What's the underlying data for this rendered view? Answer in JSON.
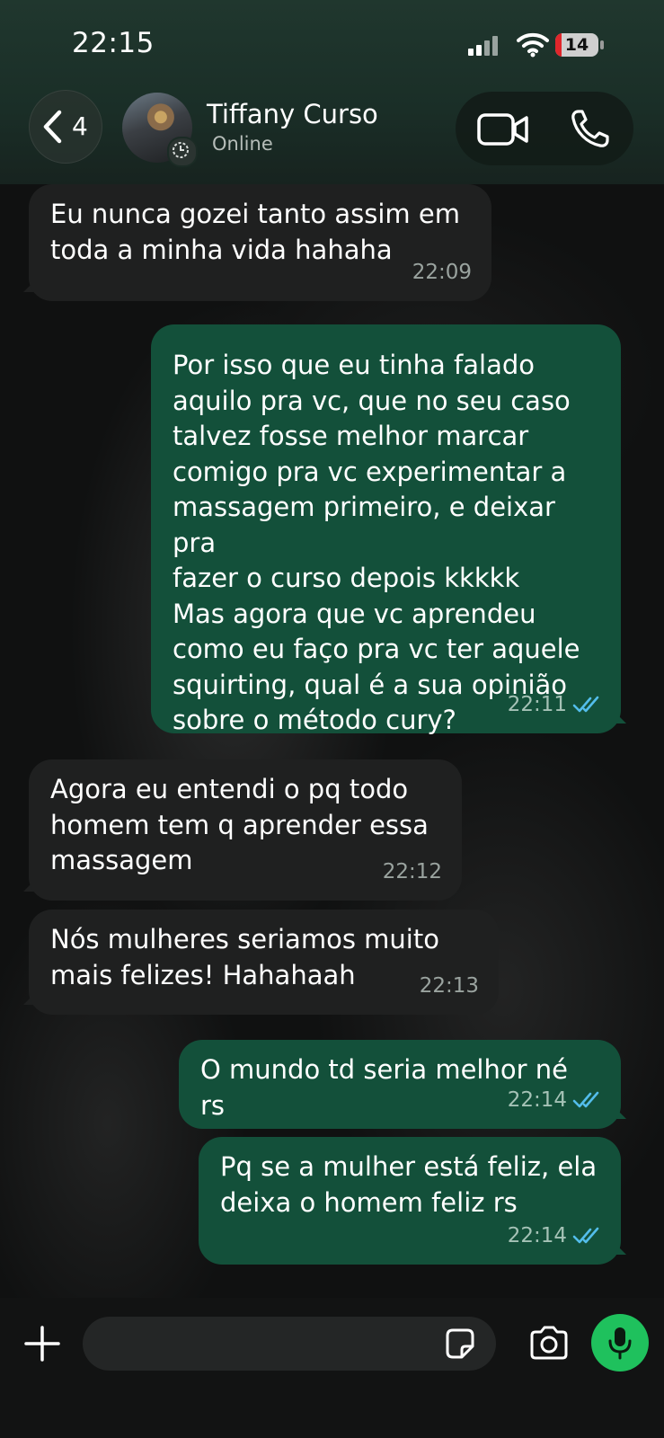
{
  "status_bar": {
    "time": "22:15",
    "battery": "14",
    "battery_fraction": 0.14
  },
  "header": {
    "back_count": "4",
    "contact_name": "Tiffany Curso",
    "contact_status": "Online"
  },
  "messages": [
    {
      "direction": "in",
      "text": "Eu nunca gozei tanto assim em\ntoda a minha vida hahaha",
      "time": "22:09"
    },
    {
      "direction": "out",
      "text": "Por isso que eu tinha falado\naquilo pra vc, que no seu caso\ntalvez fosse melhor marcar\ncomigo pra vc experimentar a\nmassagem primeiro, e deixar pra\nfazer o curso depois kkkkk\nMas agora que vc aprendeu\ncomo eu faço pra vc ter aquele\nsquirting, qual é a sua opinião\nsobre o método cury?",
      "time": "22:11",
      "status": "read"
    },
    {
      "direction": "in",
      "text": "Agora eu entendi o pq todo\nhomem tem q aprender essa\nmassagem",
      "time": "22:12"
    },
    {
      "direction": "in",
      "text": "Nós mulheres seriamos muito\nmais felizes! Hahahaah",
      "time": "22:13"
    },
    {
      "direction": "out",
      "text": "O mundo td seria melhor né rs",
      "time": "22:14",
      "status": "read"
    },
    {
      "direction": "out",
      "text": "Pq se a mulher está feliz, ela\ndeixa o homem feliz rs",
      "time": "22:14",
      "status": "read"
    }
  ],
  "composer": {
    "placeholder": ""
  },
  "colors": {
    "header": "#1d332b",
    "incoming_bubble": "#1f2020",
    "outgoing_bubble": "#13503a",
    "read_ticks": "#53bdeb",
    "mic_button": "#1fc15d"
  },
  "icons": {
    "back": "chevron-left-icon",
    "video": "video-camera-icon",
    "call": "phone-icon",
    "add": "plus-icon",
    "sticker": "sticker-icon",
    "camera": "camera-icon",
    "mic": "microphone-icon",
    "read": "double-check-icon"
  }
}
